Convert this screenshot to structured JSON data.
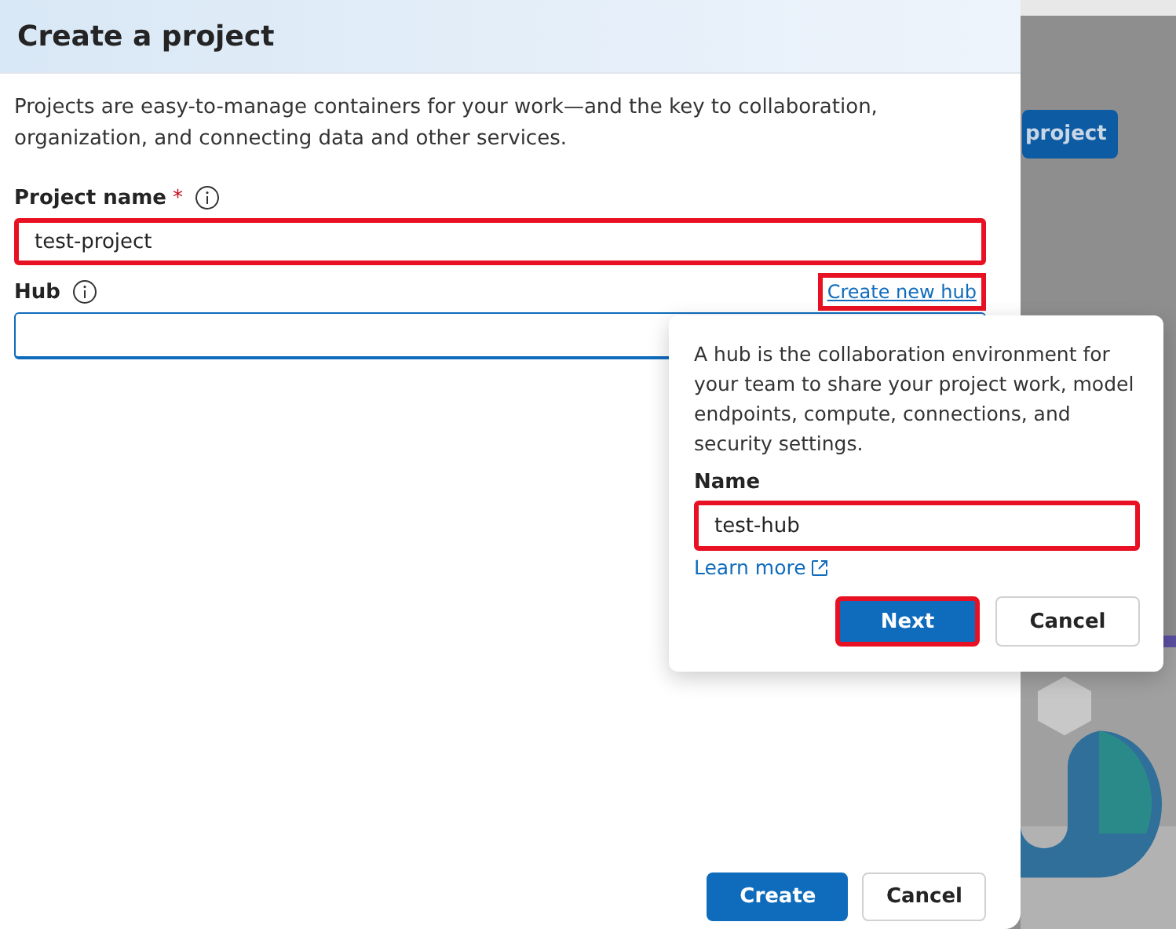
{
  "background": {
    "button": "project"
  },
  "panel": {
    "title": "Create a project",
    "description": "Projects are easy-to-manage containers for your work—and the key to collaboration, organization, and connecting data and other services.",
    "fields": [
      {
        "label": "Project name",
        "required_mark": "*",
        "value": "test-project",
        "highlighted": true,
        "focused": false
      },
      {
        "label": "Hub",
        "focused": true,
        "highlighted": false,
        "link": {
          "label": "Create new hub",
          "highlighted": true
        }
      }
    ],
    "buttons": [
      {
        "label": "Create",
        "primary": true
      },
      {
        "label": "Cancel",
        "primary": false
      }
    ]
  },
  "popover": {
    "text": "A hub is the collaboration environment for your team to share your project work, model endpoints, compute, connections, and security settings.",
    "field": {
      "label": "Name",
      "value": "test-hub",
      "highlighted": true
    },
    "link": "Learn more",
    "buttons": [
      {
        "label": "Next",
        "primary": true,
        "highlighted": true
      },
      {
        "label": "Cancel",
        "primary": false,
        "highlighted": false
      }
    ]
  }
}
